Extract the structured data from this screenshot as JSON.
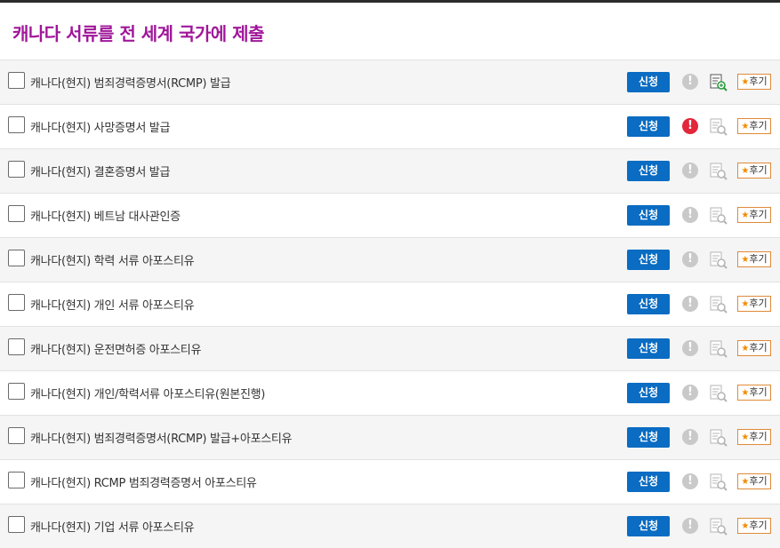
{
  "page": {
    "title": "캐나다 서류를 전 세계 국가에 제출"
  },
  "colors": {
    "title": "#a0179a",
    "apply_button": "#0a6cc2",
    "alert_active": "#e3263a",
    "review_border": "#e08a38"
  },
  "icons": {
    "alert": "exclamation-circle-icon",
    "detail": "document-magnifier-icon",
    "review_star": "star-icon"
  },
  "services": [
    {
      "name": "캐나다(현지) 범죄경력증명서(RCMP) 발급",
      "apply": "신청",
      "review": "후기",
      "alert_active": false,
      "detail_active": true
    },
    {
      "name": "캐나다(현지) 사망증명서 발급",
      "apply": "신청",
      "review": "후기",
      "alert_active": true,
      "detail_active": false
    },
    {
      "name": "캐나다(현지) 결혼증명서 발급",
      "apply": "신청",
      "review": "후기",
      "alert_active": false,
      "detail_active": false
    },
    {
      "name": "캐나다(현지) 베트남 대사관인증",
      "apply": "신청",
      "review": "후기",
      "alert_active": false,
      "detail_active": false
    },
    {
      "name": "캐나다(현지) 학력 서류 아포스티유",
      "apply": "신청",
      "review": "후기",
      "alert_active": false,
      "detail_active": false
    },
    {
      "name": "캐나다(현지) 개인 서류 아포스티유",
      "apply": "신청",
      "review": "후기",
      "alert_active": false,
      "detail_active": false
    },
    {
      "name": "캐나다(현지) 운전면허증 아포스티유",
      "apply": "신청",
      "review": "후기",
      "alert_active": false,
      "detail_active": false
    },
    {
      "name": "캐나다(현지) 개인/학력서류 아포스티유(원본진행)",
      "apply": "신청",
      "review": "후기",
      "alert_active": false,
      "detail_active": false
    },
    {
      "name": "캐나다(현지) 범죄경력증명서(RCMP) 발급+아포스티유",
      "apply": "신청",
      "review": "후기",
      "alert_active": false,
      "detail_active": false
    },
    {
      "name": "캐나다(현지) RCMP 범죄경력증명서 아포스티유",
      "apply": "신청",
      "review": "후기",
      "alert_active": false,
      "detail_active": false
    },
    {
      "name": "캐나다(현지) 기업 서류 아포스티유",
      "apply": "신청",
      "review": "후기",
      "alert_active": false,
      "detail_active": false
    }
  ]
}
